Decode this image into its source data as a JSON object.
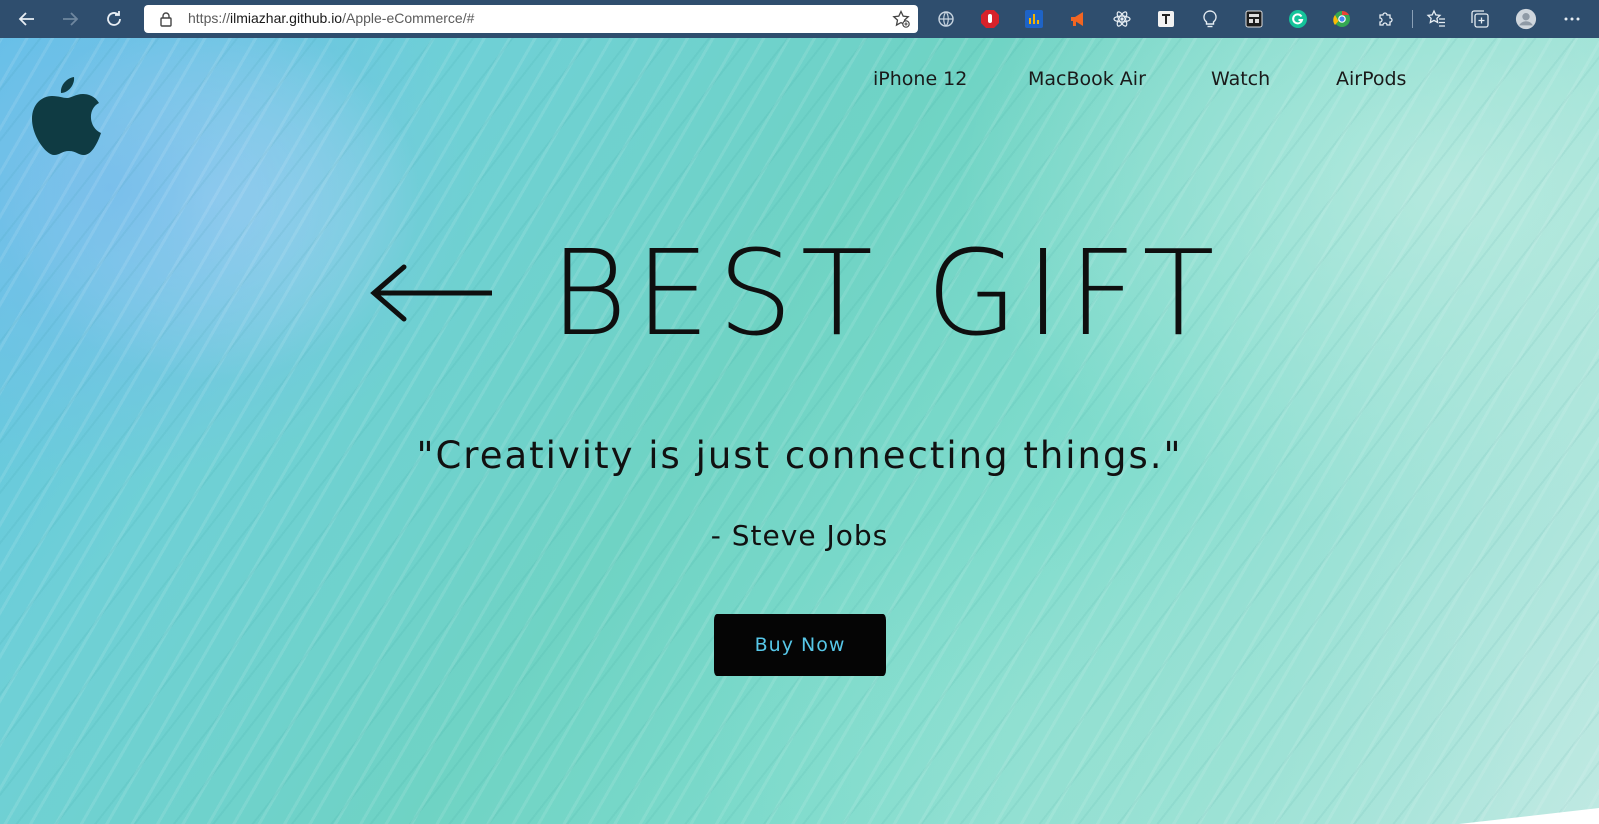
{
  "browser": {
    "url_prefix": "https://",
    "url_host": "ilmiazhar.github.io",
    "url_path": "/Apple-eCommerce/#",
    "icons": [
      "back-icon",
      "forward-icon",
      "refresh-icon",
      "lock-icon",
      "add-favorite-icon",
      "globe-icon",
      "adblock-icon",
      "analytics-icon",
      "megaphone-icon",
      "react-icon",
      "text-icon",
      "bulb-icon",
      "calculator-icon",
      "grammarly-icon",
      "chrome-ext-icon",
      "puzzle-icon",
      "favorites-icon",
      "collections-icon",
      "profile-icon",
      "more-icon"
    ]
  },
  "site": {
    "logo": "apple-logo",
    "nav": [
      "iPhone 12",
      "MacBook Air",
      "Watch",
      "AirPods"
    ],
    "hero": {
      "title": "BEST GIFT",
      "quote": "\"Creativity is just connecting things.\"",
      "author": "- Steve Jobs",
      "cta": "Buy Now"
    }
  },
  "colors": {
    "chrome": "#2f4e6e",
    "button_bg": "#050505",
    "button_text": "#57c7e8",
    "text": "#111111"
  }
}
